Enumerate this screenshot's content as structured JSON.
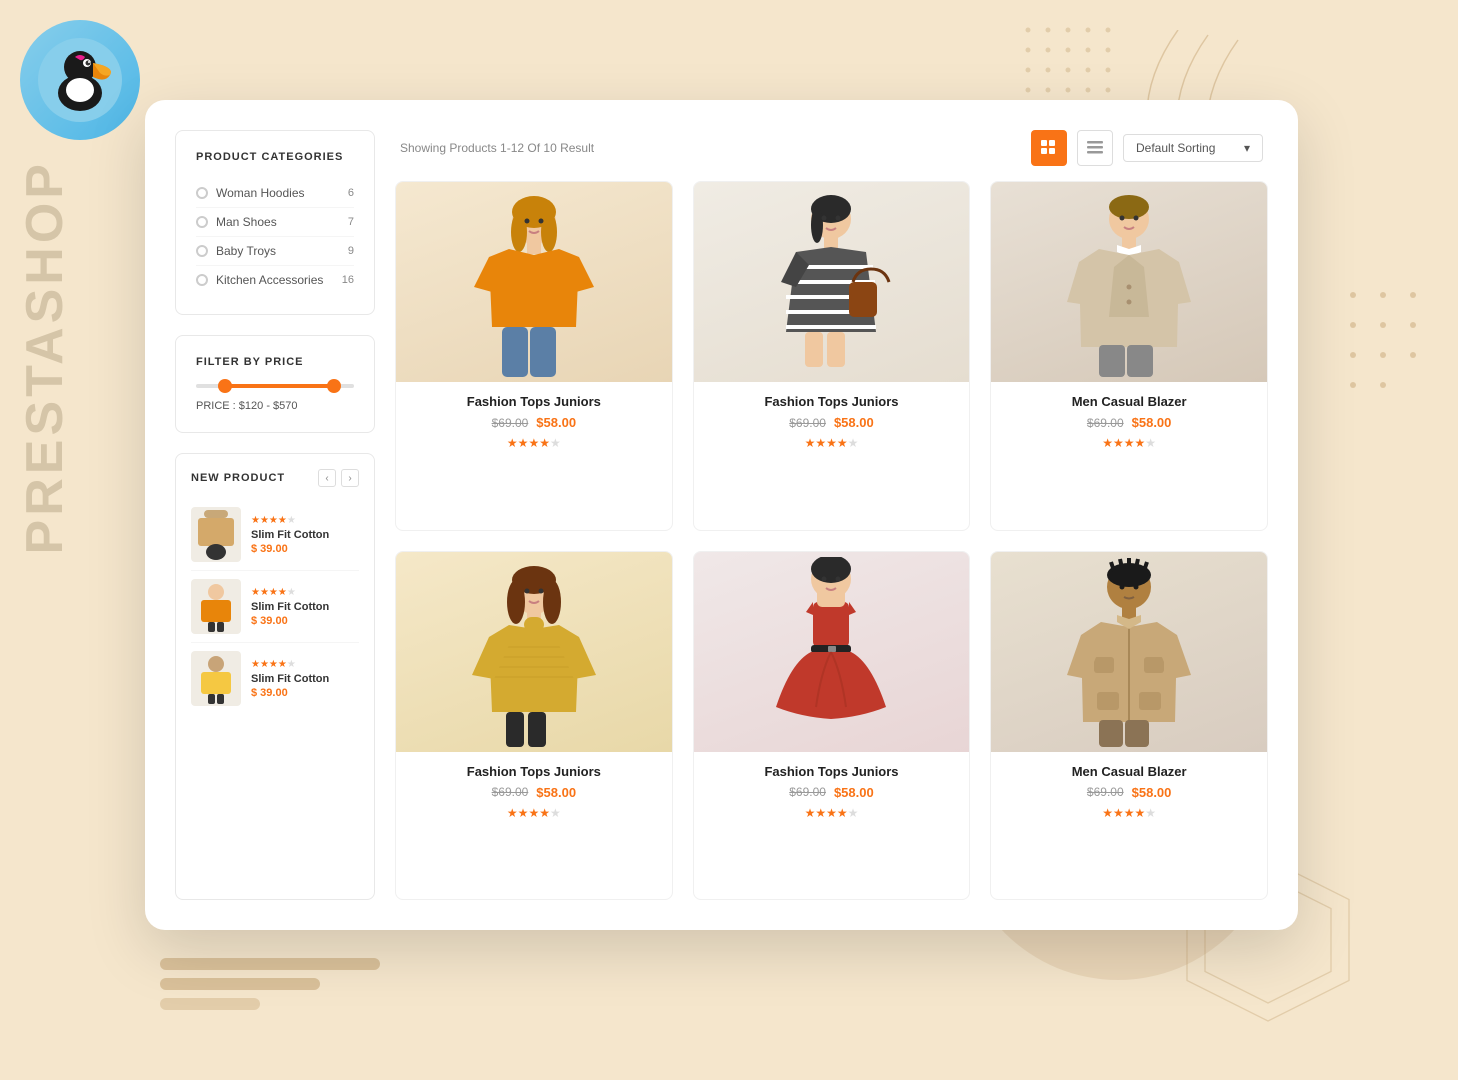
{
  "page": {
    "background_color": "#f5e6cc"
  },
  "sidebar_text": "PRESTASHOP",
  "categories": {
    "title": "PRODUCT CATEGORIES",
    "items": [
      {
        "name": "Woman Hoodies",
        "count": "6"
      },
      {
        "name": "Man Shoes",
        "count": "7"
      },
      {
        "name": "Baby Troys",
        "count": "9"
      },
      {
        "name": "Kitchen Accessories",
        "count": "16"
      }
    ]
  },
  "price_filter": {
    "title": "FILTER BY PRICE",
    "range": "PRICE :  $120 - $570"
  },
  "new_product": {
    "title": "NEW PRODUCT",
    "items": [
      {
        "name": "Slim Fit Cotton",
        "price": "$ 39.00",
        "stars": 4.5
      },
      {
        "name": "Slim Fit Cotton",
        "price": "$ 39.00",
        "stars": 4.0
      },
      {
        "name": "Slim Fit Cotton",
        "price": "$ 39.00",
        "stars": 4.0
      }
    ]
  },
  "toolbar": {
    "showing_text": "Showing Products 1-12 Of 10 Result",
    "sort_label": "Default Sorting",
    "sort_arrow": "▾"
  },
  "products": [
    {
      "title": "Fashion Tops Juniors",
      "original_price": "$69.00",
      "sale_price": "$58.00",
      "stars": 4,
      "color": "orange",
      "emoji": "👗"
    },
    {
      "title": "Fashion Tops Juniors",
      "original_price": "$69.00",
      "sale_price": "$58.00",
      "stars": 4,
      "color": "striped",
      "emoji": "👔"
    },
    {
      "title": "Men Casual Blazer",
      "original_price": "$69.00",
      "sale_price": "$58.00",
      "stars": 4,
      "color": "beige",
      "emoji": "🧥"
    },
    {
      "title": "Fashion Tops Juniors",
      "original_price": "$69.00",
      "sale_price": "$58.00",
      "stars": 4,
      "color": "yellow",
      "emoji": "🧶"
    },
    {
      "title": "Fashion Tops Juniors",
      "original_price": "$69.00",
      "sale_price": "$58.00",
      "stars": 4,
      "color": "red",
      "emoji": "👘"
    },
    {
      "title": "Men Casual Blazer",
      "original_price": "$69.00",
      "sale_price": "$58.00",
      "stars": 4,
      "color": "tan",
      "emoji": "🥼"
    }
  ],
  "icons": {
    "grid": "⊞",
    "list": "≡",
    "arrow_left": "‹",
    "arrow_right": "›",
    "chevron_down": "▾"
  }
}
